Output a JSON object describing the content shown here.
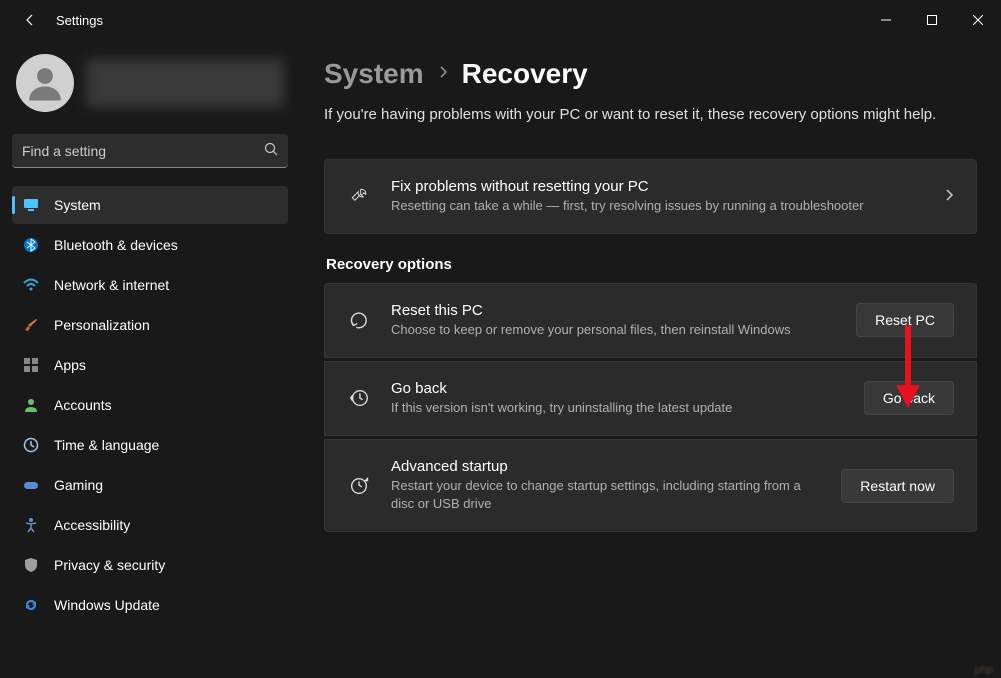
{
  "window": {
    "title": "Settings"
  },
  "search": {
    "placeholder": "Find a setting"
  },
  "sidebar": {
    "items": [
      {
        "label": "System",
        "icon": "monitor",
        "color": "#4cc2ff",
        "active": true
      },
      {
        "label": "Bluetooth & devices",
        "icon": "bluetooth",
        "color": "#0078d4"
      },
      {
        "label": "Network & internet",
        "icon": "wifi",
        "color": "#2ea8e0"
      },
      {
        "label": "Personalization",
        "icon": "brush",
        "color": "#d87a3a"
      },
      {
        "label": "Apps",
        "icon": "apps",
        "color": "#888"
      },
      {
        "label": "Accounts",
        "icon": "person",
        "color": "#6abf6a"
      },
      {
        "label": "Time & language",
        "icon": "clock",
        "color": "#a0c8e8"
      },
      {
        "label": "Gaming",
        "icon": "gamepad",
        "color": "#5a8dd0"
      },
      {
        "label": "Accessibility",
        "icon": "accessibility",
        "color": "#6a8fc7"
      },
      {
        "label": "Privacy & security",
        "icon": "shield",
        "color": "#9e9e9e"
      },
      {
        "label": "Windows Update",
        "icon": "update",
        "color": "#2e8de0"
      }
    ]
  },
  "breadcrumb": {
    "parent": "System",
    "current": "Recovery"
  },
  "subtitle": "If you're having problems with your PC or want to reset it, these recovery options might help.",
  "cards": {
    "fix": {
      "title": "Fix problems without resetting your PC",
      "desc": "Resetting can take a while — first, try resolving issues by running a troubleshooter"
    }
  },
  "section_title": "Recovery options",
  "recovery": [
    {
      "title": "Reset this PC",
      "desc": "Choose to keep or remove your personal files, then reinstall Windows",
      "button": "Reset PC",
      "icon": "reset"
    },
    {
      "title": "Go back",
      "desc": "If this version isn't working, try uninstalling the latest update",
      "button": "Go back",
      "icon": "history"
    },
    {
      "title": "Advanced startup",
      "desc": "Restart your device to change startup settings, including starting from a disc or USB drive",
      "button": "Restart now",
      "icon": "advanced"
    }
  ]
}
